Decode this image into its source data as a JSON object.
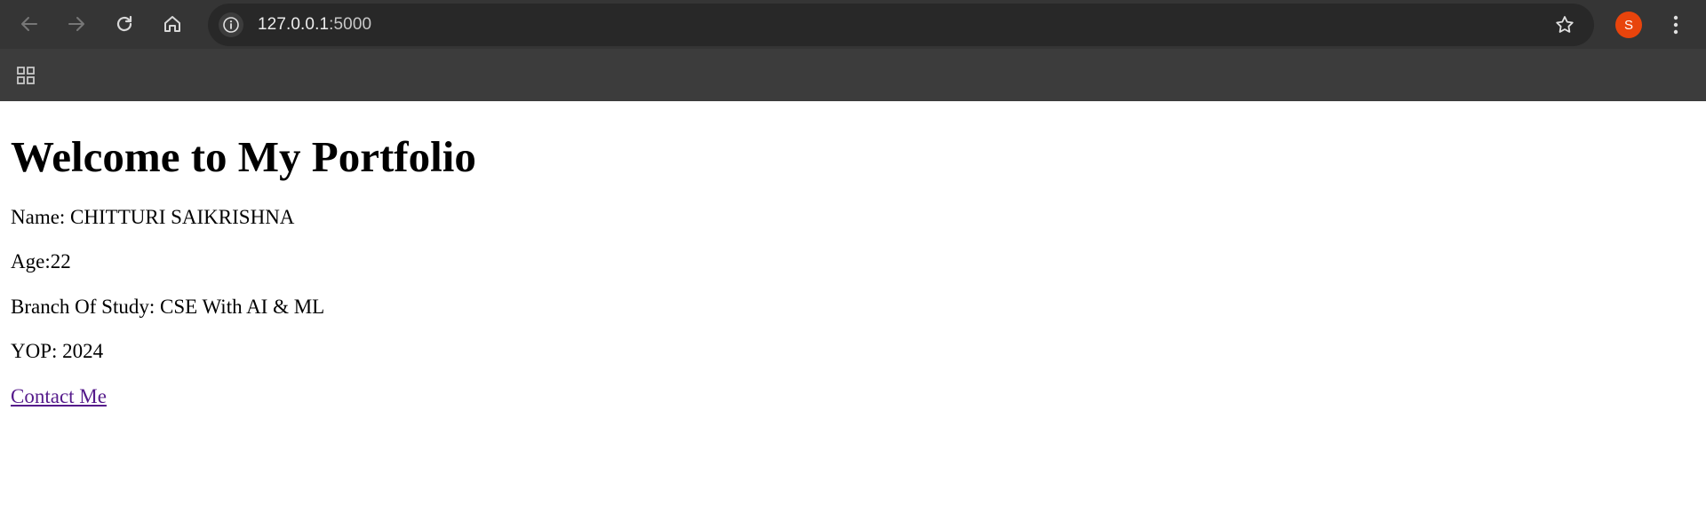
{
  "browser": {
    "url_host": "127.0.0.1",
    "url_port": ":5000",
    "profile_initial": "S",
    "profile_color": "#e8440c",
    "icons": {
      "back": "arrow-left-icon",
      "forward": "arrow-right-icon",
      "reload": "reload-icon",
      "home": "home-icon",
      "site_info": "info-icon",
      "bookmark": "star-icon",
      "menu": "kebab-menu-icon",
      "apps": "apps-grid-icon"
    }
  },
  "page": {
    "heading": "Welcome to My Portfolio",
    "name_line": "Name: CHITTURI SAIKRISHNA",
    "age_line": "Age:22",
    "branch_line": "Branch Of Study: CSE With AI & ML",
    "yop_line": "YOP: 2024",
    "contact_link": "Contact Me",
    "link_color": "#551a8b"
  }
}
